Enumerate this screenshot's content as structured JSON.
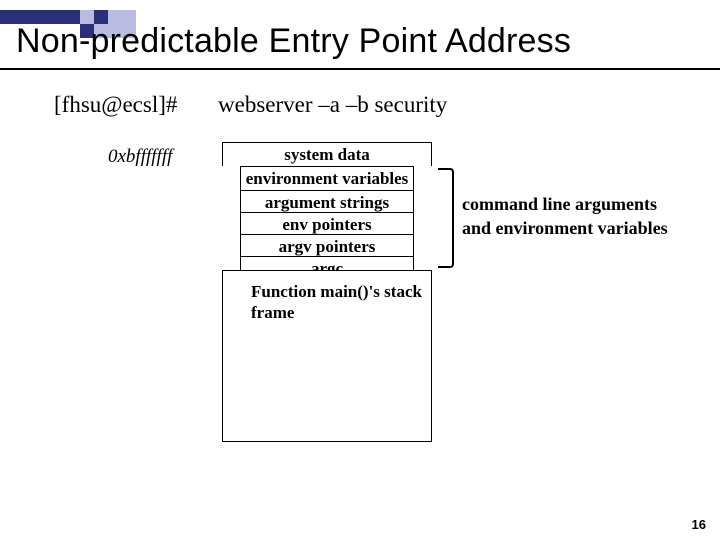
{
  "title": "Non-predictable Entry Point Address",
  "prompt": "[fhsu@ecsl]#",
  "command": "webserver –a –b security",
  "address_label": "0xbfffffff",
  "stack_rows": {
    "sysdata": "system data",
    "env_vars": "environment variables",
    "arg_strings": "argument strings",
    "env_ptrs": "env pointers",
    "argv_ptrs": "argv pointers",
    "argc": "argc"
  },
  "stack_frame_label": "Function main()'s stack frame",
  "caption_line1": "command line arguments",
  "caption_line2": "and environment variables",
  "page_number": "16"
}
